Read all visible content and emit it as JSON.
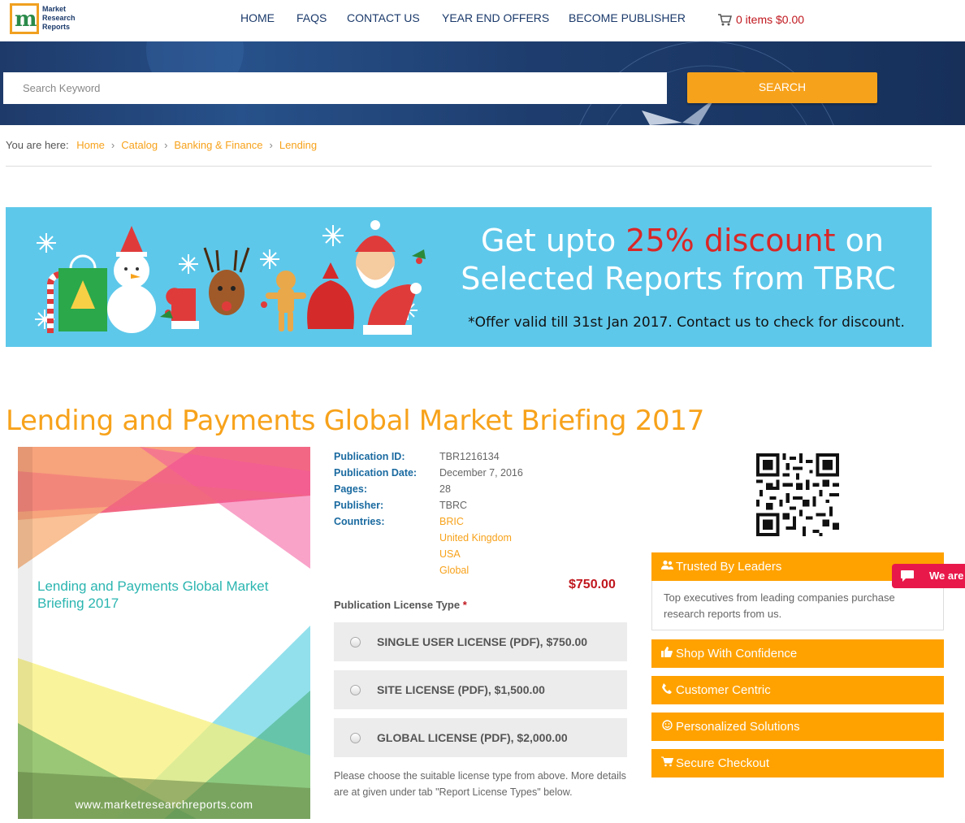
{
  "header": {
    "logo_lines": [
      "Market",
      "Research",
      "Reports"
    ],
    "nav": [
      "HOME",
      "FAQS",
      "CONTACT US",
      "YEAR END OFFERS",
      "BECOME PUBLISHER"
    ],
    "cart": "0 items $0.00"
  },
  "search": {
    "placeholder": "Search Keyword",
    "button": "SEARCH"
  },
  "breadcrumb": {
    "prefix": "You are here:",
    "items": [
      "Home",
      "Catalog",
      "Banking & Finance",
      "Lending"
    ]
  },
  "banner": {
    "line1_pre": "Get upto ",
    "line1_highlight": "25% discount",
    "line1_post": " on",
    "line2": "Selected Reports from TBRC",
    "line3": "*Offer valid till 31st Jan 2017. Contact us to check for discount."
  },
  "product": {
    "title": "Lending and Payments Global Market Briefing 2017",
    "cover_title": "Lending and Payments Global Market Briefing 2017",
    "cover_url": "www.marketresearchreports.com",
    "details": [
      {
        "label": "Publication ID:",
        "value": "TBR1216134"
      },
      {
        "label": "Publication Date:",
        "value": "December 7, 2016"
      },
      {
        "label": "Pages:",
        "value": "28"
      },
      {
        "label": "Publisher:",
        "value": "TBRC"
      },
      {
        "label": "Countries:",
        "value": "BRIC"
      }
    ],
    "countries_more": [
      "United Kingdom",
      "USA",
      "Global"
    ],
    "price": "$750.00",
    "license_label": "Publication License Type",
    "license_required": "*",
    "licenses": [
      "SINGLE USER LICENSE (PDF), $750.00",
      "SITE LICENSE (PDF), $1,500.00",
      "GLOBAL LICENSE (PDF), $2,000.00"
    ],
    "note": "Please choose the suitable license type from above. More details are at given under tab \"Report License Types\" below."
  },
  "sidebar": {
    "trusted_title": "Trusted By Leaders",
    "trusted_body": "Top executives from leading companies purchase research reports from us.",
    "items": [
      "Shop With Confidence",
      "Customer Centric",
      "Personalized Solutions",
      "Secure Checkout"
    ]
  },
  "chat": {
    "label": "We are"
  },
  "colors": {
    "accent": "#f7a21b",
    "header_blue": "#1b3a6b",
    "price_red": "#c0171e",
    "banner_bg": "#5ec8ea"
  }
}
